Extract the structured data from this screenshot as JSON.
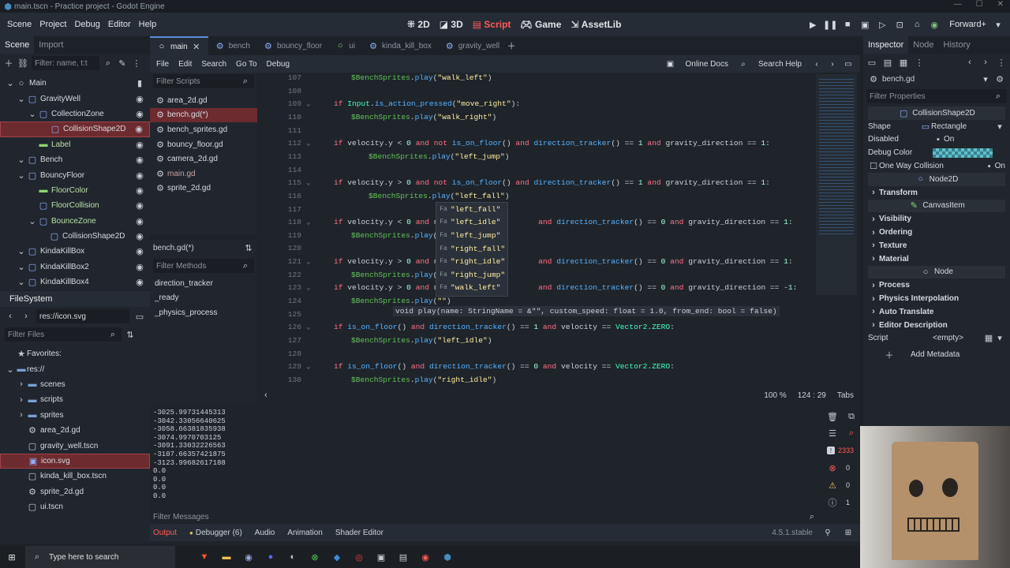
{
  "window": {
    "title": "main.tscn - Practice project - Godot Engine"
  },
  "menubar": {
    "menus": [
      "Scene",
      "Project",
      "Debug",
      "Editor",
      "Help"
    ],
    "workspaces": [
      "2D",
      "3D",
      "Script",
      "Game",
      "AssetLib"
    ],
    "active_workspace": "Script",
    "renderer": "Forward+"
  },
  "scene_panel": {
    "tabs": [
      "Scene",
      "Import"
    ],
    "filter_placeholder": "Filter: name, t:t",
    "nodes": [
      {
        "label": "Main",
        "depth": 0,
        "icon": "node-icon"
      },
      {
        "label": "GravityWell",
        "depth": 1,
        "icon": "area2d-icon"
      },
      {
        "label": "CollectionZone",
        "depth": 2,
        "icon": "area2d-icon"
      },
      {
        "label": "CollisionShape2D",
        "depth": 3,
        "icon": "collision-shape-icon",
        "selected": true
      },
      {
        "label": "Label",
        "depth": 2,
        "icon": "label-icon"
      },
      {
        "label": "Bench",
        "depth": 1,
        "icon": "node2d-icon"
      },
      {
        "label": "BouncyFloor",
        "depth": 1,
        "icon": "node2d-icon"
      },
      {
        "label": "FloorColor",
        "depth": 2,
        "icon": "colorrect-icon"
      },
      {
        "label": "FloorCollision",
        "depth": 2,
        "icon": "staticbody-icon"
      },
      {
        "label": "BounceZone",
        "depth": 2,
        "icon": "area2d-icon"
      },
      {
        "label": "CollisionShape2D",
        "depth": 3,
        "icon": "collision-shape-icon"
      },
      {
        "label": "KindaKillBox",
        "depth": 1,
        "icon": "node2d-icon"
      },
      {
        "label": "KindaKillBox2",
        "depth": 1,
        "icon": "node2d-icon"
      },
      {
        "label": "KindaKillBox4",
        "depth": 1,
        "icon": "node2d-icon"
      }
    ]
  },
  "filesystem": {
    "title": "FileSystem",
    "path": "res://icon.svg",
    "filter_placeholder": "Filter Files",
    "favorites_label": "Favorites:",
    "root": "res://",
    "items": [
      {
        "label": "scenes",
        "type": "folder"
      },
      {
        "label": "scripts",
        "type": "folder"
      },
      {
        "label": "sprites",
        "type": "folder"
      },
      {
        "label": "area_2d.gd",
        "type": "script"
      },
      {
        "label": "gravity_well.tscn",
        "type": "scene"
      },
      {
        "label": "icon.svg",
        "type": "image",
        "selected": true
      },
      {
        "label": "kinda_kill_box.tscn",
        "type": "scene"
      },
      {
        "label": "sprite_2d.gd",
        "type": "script"
      },
      {
        "label": "ui.tscn",
        "type": "scene"
      }
    ]
  },
  "editor_tabs": [
    "main",
    "bench",
    "bouncy_floor",
    "ui",
    "kinda_kill_box",
    "gravity_well"
  ],
  "script_menu": [
    "File",
    "Edit",
    "Search",
    "Go To",
    "Debug"
  ],
  "script_menu_right": [
    "Online Docs",
    "Search Help"
  ],
  "scripts": {
    "filter_placeholder": "Filter Scripts",
    "items": [
      {
        "label": "area_2d.gd"
      },
      {
        "label": "bench.gd(*)",
        "selected": true
      },
      {
        "label": "bench_sprites.gd"
      },
      {
        "label": "bouncy_floor.gd"
      },
      {
        "label": "camera_2d.gd"
      },
      {
        "label": "main.gd",
        "dim": true
      },
      {
        "label": "sprite_2d.gd"
      }
    ],
    "current": "bench.gd(*)",
    "methods_placeholder": "Filter Methods",
    "methods": [
      "direction_tracker",
      "_ready",
      "_physics_process"
    ]
  },
  "code": {
    "lines": [
      {
        "n": "107",
        "indent": 1,
        "text": "$BenchSprites.play(\"walk_left\")"
      },
      {
        "n": "108",
        "indent": 0,
        "text": ""
      },
      {
        "n": "109",
        "indent": 0,
        "text": "if Input.is_action_pressed(\"move_right\"):"
      },
      {
        "n": "110",
        "indent": 1,
        "text": "$BenchSprites.play(\"walk_right\")"
      },
      {
        "n": "111",
        "indent": 0,
        "text": ""
      },
      {
        "n": "112",
        "indent": 0,
        "text": "if velocity.y < 0 and not is_on_floor() and direction_tracker() == 1 and gravity_direction == 1:"
      },
      {
        "n": "113",
        "indent": 2,
        "text": "$BenchSprites.play(\"left_jump\")"
      },
      {
        "n": "114",
        "indent": 0,
        "text": ""
      },
      {
        "n": "115",
        "indent": 0,
        "text": "if velocity.y > 0 and not is_on_floor() and direction_tracker() == 1 and gravity_direction == 1:"
      },
      {
        "n": "116",
        "indent": 2,
        "text": "$BenchSprites.play(\"left_fall\")"
      },
      {
        "n": "117",
        "indent": 0,
        "text": ""
      },
      {
        "n": "118",
        "indent": 0,
        "text": "if velocity.y < 0 and n                      and direction_tracker() == 0 and gravity_direction == 1:"
      },
      {
        "n": "119",
        "indent": 1,
        "text": "$BenchSprites.play("
      },
      {
        "n": "120",
        "indent": 0,
        "text": ""
      },
      {
        "n": "121",
        "indent": 0,
        "text": "if velocity.y > 0 and n                      and direction_tracker() == 0 and gravity_direction == 1:"
      },
      {
        "n": "122",
        "indent": 1,
        "text": "$BenchSprites.play("
      },
      {
        "n": "123",
        "indent": 0,
        "text": "if velocity.y > 0 and n                      and direction_tracker() == 0 and gravity_direction == -1:"
      },
      {
        "n": "124",
        "indent": 1,
        "text": "$BenchSprites.play(\"\")"
      },
      {
        "n": "125",
        "indent": 0,
        "text": ""
      },
      {
        "n": "126",
        "indent": 0,
        "text": "if is_on_floor() and direction_tracker() == 1 and velocity == Vector2.ZERO:"
      },
      {
        "n": "127",
        "indent": 1,
        "text": "$BenchSprites.play(\"left_idle\")"
      },
      {
        "n": "128",
        "indent": 0,
        "text": ""
      },
      {
        "n": "129",
        "indent": 0,
        "text": "if is_on_floor() and direction_tracker() == 0 and velocity == Vector2.ZERO:"
      },
      {
        "n": "130",
        "indent": 1,
        "text": "$BenchSprites.play(\"right_idle\")"
      }
    ],
    "completion": [
      "\"left_fall\"",
      "\"left_idle\"",
      "\"left_jump\"",
      "\"right_fall\"",
      "\"right_idle\"",
      "\"right_jump\"",
      "\"walk_left\""
    ],
    "completion_kind": "Fa",
    "hint": "void play(name: StringName = &\"\", custom_speed: float = 1.0, from_end: bool = false)",
    "zoom": "100 %",
    "cursor": "124 :  29",
    "indent_mode": "Tabs"
  },
  "output": {
    "lines": [
      "-3025.99731445313",
      "-3042.33056640625",
      "-3058.66381835938",
      "-3074.9970703125",
      "-3091.33032226563",
      "-3107.66357421875",
      "-3123.99682617188",
      "0.0",
      "0.0",
      "0.0",
      "0.0"
    ],
    "filter_placeholder": "Filter Messages",
    "error_count": "2333",
    "counts": [
      "0",
      "0",
      "1"
    ]
  },
  "bottom_tabs": [
    "Output",
    "Debugger (6)",
    "Audio",
    "Animation",
    "Shader Editor"
  ],
  "version": "4.5.1.stable",
  "inspector": {
    "tabs": [
      "Inspector",
      "Node",
      "History"
    ],
    "resource": "bench.gd",
    "filter_placeholder": "Filter Properties",
    "class_name": "CollisionShape2D",
    "shape_label": "Shape",
    "shape_value": "Rectangle",
    "disabled_label": "Disabled",
    "disabled_value": "On",
    "debug_color_label": "Debug Color",
    "one_way_label": "One Way Collision",
    "one_way_value": "On",
    "node2d": "Node2D",
    "transform": "Transform",
    "canvas_item": "CanvasItem",
    "canvas_sections": [
      "Visibility",
      "Ordering",
      "Texture",
      "Material"
    ],
    "node": "Node",
    "node_sections": [
      "Process",
      "Physics Interpolation",
      "Auto Translate",
      "Editor Description"
    ],
    "script_label": "Script",
    "script_value": "<empty>",
    "add_metadata": "Add Metadata"
  },
  "taskbar": {
    "search_placeholder": "Type here to search"
  }
}
